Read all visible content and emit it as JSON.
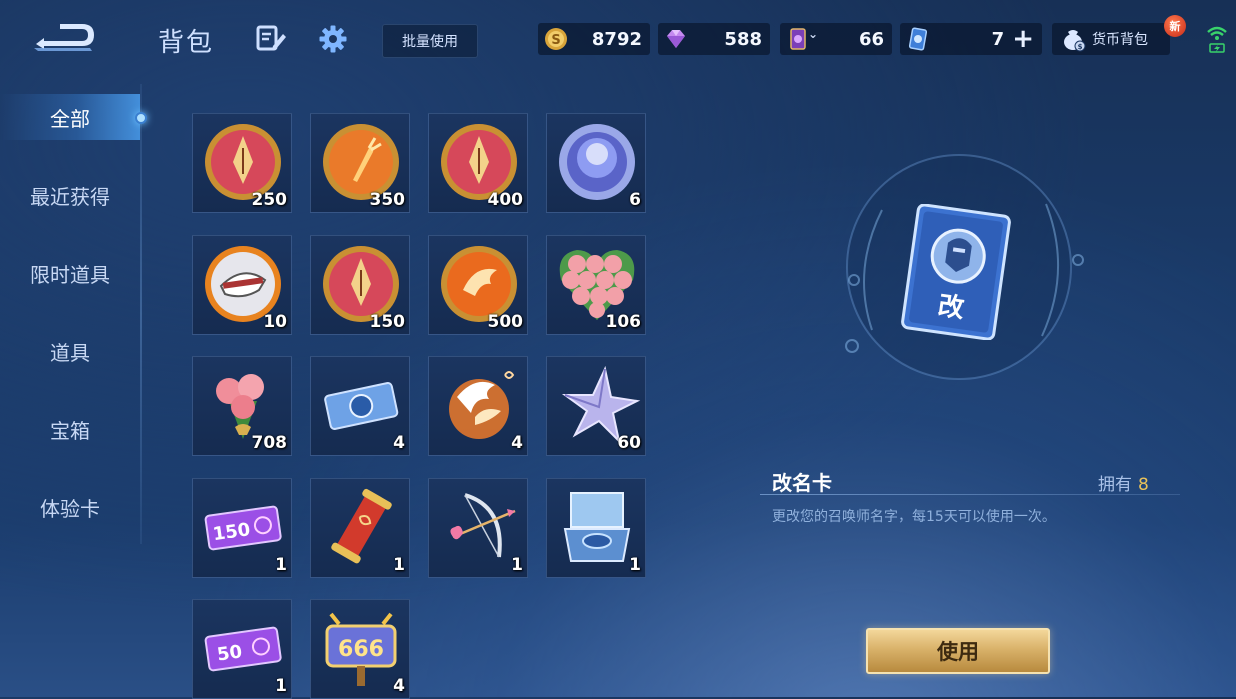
{
  "header": {
    "title": "背包",
    "batch_label": "批量使用",
    "currencies": [
      {
        "name": "gold-coin",
        "value": "8792"
      },
      {
        "name": "gem",
        "value": "588"
      },
      {
        "name": "ticket-card",
        "value": "66"
      },
      {
        "name": "blue-card",
        "value": "7"
      }
    ],
    "wallet_label": "货币背包",
    "new_badge": "新"
  },
  "sidebar": {
    "items": [
      {
        "label": "全部",
        "active": true
      },
      {
        "label": "最近获得"
      },
      {
        "label": "限时道具"
      },
      {
        "label": "道具"
      },
      {
        "label": "宝箱"
      },
      {
        "label": "体验卡"
      }
    ]
  },
  "inventory": [
    {
      "icon": "pen-token-icon",
      "qty": "250"
    },
    {
      "icon": "carrot-token-icon",
      "qty": "350"
    },
    {
      "icon": "pen-token-icon",
      "qty": "400"
    },
    {
      "icon": "blue-orb-icon",
      "qty": "6"
    },
    {
      "icon": "fox-token-icon",
      "qty": "10"
    },
    {
      "icon": "pen-token-icon",
      "qty": "150"
    },
    {
      "icon": "bird-token-icon",
      "qty": "500"
    },
    {
      "icon": "rose-heart-icon",
      "qty": "106"
    },
    {
      "icon": "rose-bouquet-icon",
      "qty": "708"
    },
    {
      "icon": "ticket-icon",
      "qty": "4"
    },
    {
      "icon": "pegasus-icon",
      "qty": "4"
    },
    {
      "icon": "star-icon",
      "qty": "60"
    },
    {
      "icon": "coupon-150-icon",
      "qty": "1",
      "text": "150"
    },
    {
      "icon": "scroll-icon",
      "qty": "1"
    },
    {
      "icon": "bow-arrow-icon",
      "qty": "1"
    },
    {
      "icon": "box-icon",
      "qty": "1"
    },
    {
      "icon": "coupon-50-icon",
      "qty": "1",
      "text": "50"
    },
    {
      "icon": "sign-666-icon",
      "qty": "4",
      "text": "666"
    }
  ],
  "detail": {
    "name": "改名卡",
    "own_label": "拥有",
    "own_count": "8",
    "description": "更改您的召唤师名字，每15天可以使用一次。",
    "card_char": "改",
    "use_label": "使用"
  }
}
